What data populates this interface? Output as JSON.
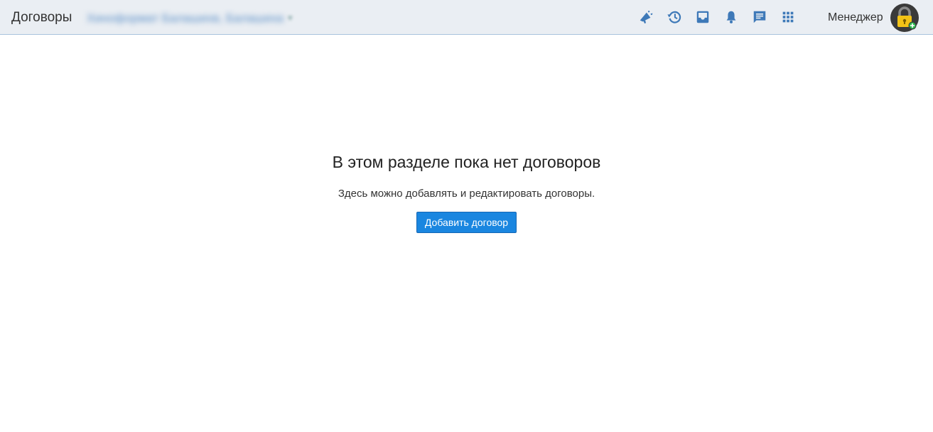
{
  "header": {
    "title": "Договоры",
    "org_name": "Хиноформат Балашихв, Балашиха",
    "role": "Менеджер",
    "icons": [
      "megaphone-icon",
      "history-icon",
      "inbox-icon",
      "bell-icon",
      "chat-icon",
      "apps-grid-icon"
    ],
    "accent_color": "#3e79b8"
  },
  "empty_state": {
    "title": "В этом разделе пока нет договоров",
    "description": "Здесь можно добавлять и редактировать договоры.",
    "add_button_label": "Добавить договор",
    "button_color": "#1a86e0"
  }
}
